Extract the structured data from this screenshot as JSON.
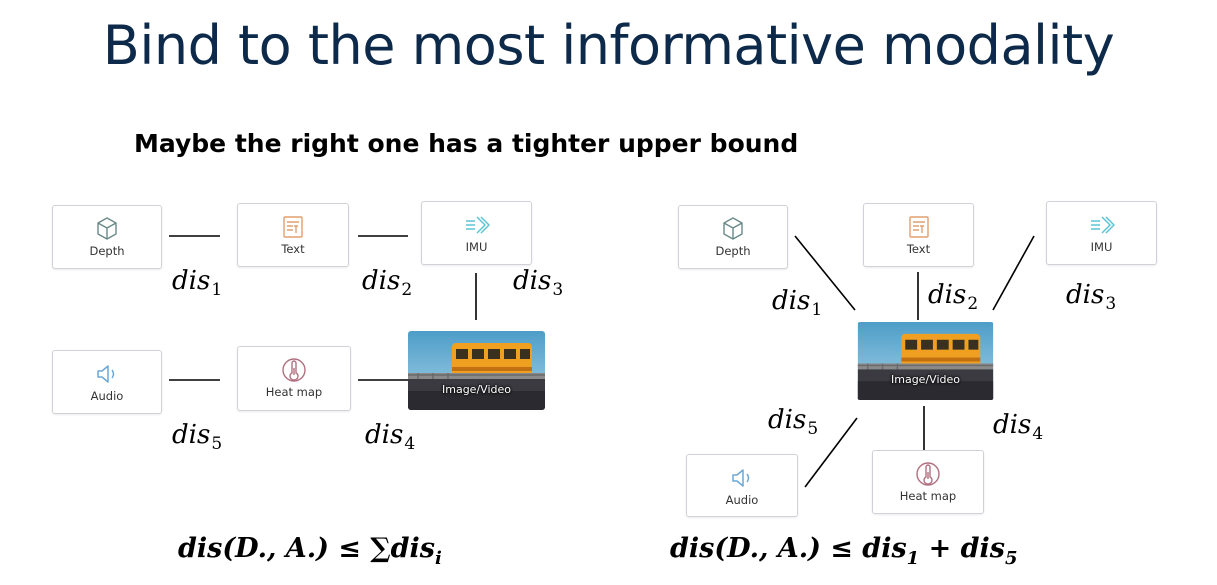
{
  "title": "Bind to the most informative modality",
  "subtitle": "Maybe the right one has a tighter upper bound",
  "cards": {
    "depth": "Depth",
    "text": "Text",
    "imu": "IMU",
    "audio": "Audio",
    "heatmap": "Heat map",
    "image": "Image/Video"
  },
  "edge_labels": {
    "dis_base": "dis",
    "sub1": "1",
    "sub2": "2",
    "sub3": "3",
    "sub4": "4",
    "sub5": "5"
  },
  "formulas": {
    "left_prefix": "dis(D., A.) ≤ ∑dis",
    "left_sub": "i",
    "right_prefix": "dis(D., A.) ≤ dis",
    "right_sub1": "1",
    "right_mid": " + dis",
    "right_sub2": "5"
  },
  "colors": {
    "title": "#0e2a4a",
    "depth_icon": "#6a8a8a",
    "text_icon": "#e0a070",
    "imu_icon": "#5cc5d5",
    "audio_icon": "#6aa8d8",
    "heatmap_icon": "#b07080"
  },
  "icons": {
    "depth": "cube-icon",
    "text": "document-icon",
    "imu": "arrow-right-icon",
    "audio": "speaker-icon",
    "heatmap": "thermometer-icon"
  }
}
